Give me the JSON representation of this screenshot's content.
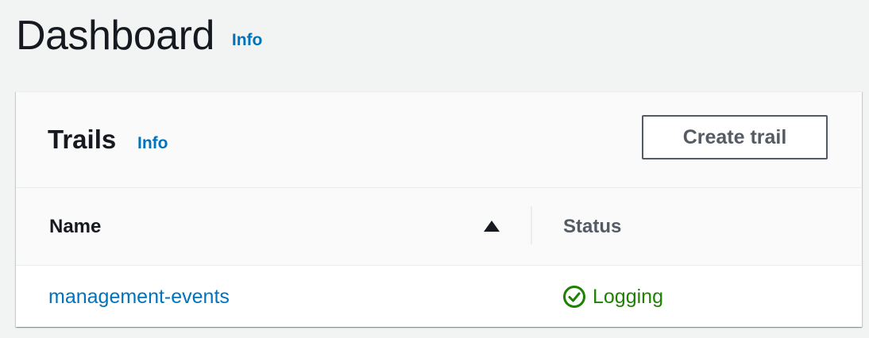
{
  "page": {
    "title": "Dashboard",
    "info_label": "Info"
  },
  "trails": {
    "title": "Trails",
    "info_label": "Info",
    "create_button_label": "Create trail",
    "columns": {
      "name": "Name",
      "status": "Status"
    },
    "sort_icon": "triangle-up-icon",
    "rows": [
      {
        "name": "management-events",
        "status": "Logging",
        "status_icon": "check-circle-icon",
        "status_color": "#1d8102"
      }
    ]
  },
  "colors": {
    "link": "#0073bb",
    "background": "#f2f3f3",
    "success": "#1d8102"
  }
}
